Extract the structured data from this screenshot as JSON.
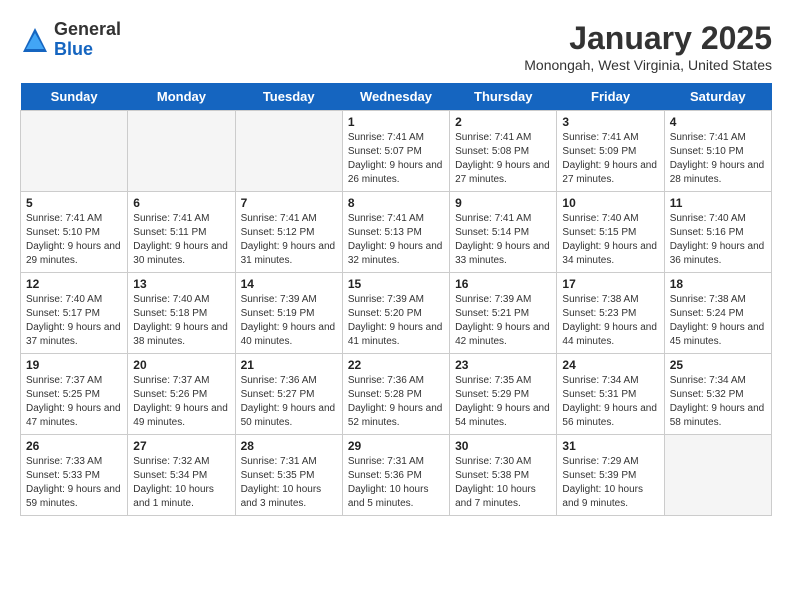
{
  "logo": {
    "general": "General",
    "blue": "Blue"
  },
  "title": "January 2025",
  "subtitle": "Monongah, West Virginia, United States",
  "days_of_week": [
    "Sunday",
    "Monday",
    "Tuesday",
    "Wednesday",
    "Thursday",
    "Friday",
    "Saturday"
  ],
  "weeks": [
    [
      {
        "day": "",
        "info": "",
        "empty": true
      },
      {
        "day": "",
        "info": "",
        "empty": true
      },
      {
        "day": "",
        "info": "",
        "empty": true
      },
      {
        "day": "1",
        "info": "Sunrise: 7:41 AM\nSunset: 5:07 PM\nDaylight: 9 hours and 26 minutes.",
        "empty": false
      },
      {
        "day": "2",
        "info": "Sunrise: 7:41 AM\nSunset: 5:08 PM\nDaylight: 9 hours and 27 minutes.",
        "empty": false
      },
      {
        "day": "3",
        "info": "Sunrise: 7:41 AM\nSunset: 5:09 PM\nDaylight: 9 hours and 27 minutes.",
        "empty": false
      },
      {
        "day": "4",
        "info": "Sunrise: 7:41 AM\nSunset: 5:10 PM\nDaylight: 9 hours and 28 minutes.",
        "empty": false
      }
    ],
    [
      {
        "day": "5",
        "info": "Sunrise: 7:41 AM\nSunset: 5:10 PM\nDaylight: 9 hours and 29 minutes.",
        "empty": false
      },
      {
        "day": "6",
        "info": "Sunrise: 7:41 AM\nSunset: 5:11 PM\nDaylight: 9 hours and 30 minutes.",
        "empty": false
      },
      {
        "day": "7",
        "info": "Sunrise: 7:41 AM\nSunset: 5:12 PM\nDaylight: 9 hours and 31 minutes.",
        "empty": false
      },
      {
        "day": "8",
        "info": "Sunrise: 7:41 AM\nSunset: 5:13 PM\nDaylight: 9 hours and 32 minutes.",
        "empty": false
      },
      {
        "day": "9",
        "info": "Sunrise: 7:41 AM\nSunset: 5:14 PM\nDaylight: 9 hours and 33 minutes.",
        "empty": false
      },
      {
        "day": "10",
        "info": "Sunrise: 7:40 AM\nSunset: 5:15 PM\nDaylight: 9 hours and 34 minutes.",
        "empty": false
      },
      {
        "day": "11",
        "info": "Sunrise: 7:40 AM\nSunset: 5:16 PM\nDaylight: 9 hours and 36 minutes.",
        "empty": false
      }
    ],
    [
      {
        "day": "12",
        "info": "Sunrise: 7:40 AM\nSunset: 5:17 PM\nDaylight: 9 hours and 37 minutes.",
        "empty": false
      },
      {
        "day": "13",
        "info": "Sunrise: 7:40 AM\nSunset: 5:18 PM\nDaylight: 9 hours and 38 minutes.",
        "empty": false
      },
      {
        "day": "14",
        "info": "Sunrise: 7:39 AM\nSunset: 5:19 PM\nDaylight: 9 hours and 40 minutes.",
        "empty": false
      },
      {
        "day": "15",
        "info": "Sunrise: 7:39 AM\nSunset: 5:20 PM\nDaylight: 9 hours and 41 minutes.",
        "empty": false
      },
      {
        "day": "16",
        "info": "Sunrise: 7:39 AM\nSunset: 5:21 PM\nDaylight: 9 hours and 42 minutes.",
        "empty": false
      },
      {
        "day": "17",
        "info": "Sunrise: 7:38 AM\nSunset: 5:23 PM\nDaylight: 9 hours and 44 minutes.",
        "empty": false
      },
      {
        "day": "18",
        "info": "Sunrise: 7:38 AM\nSunset: 5:24 PM\nDaylight: 9 hours and 45 minutes.",
        "empty": false
      }
    ],
    [
      {
        "day": "19",
        "info": "Sunrise: 7:37 AM\nSunset: 5:25 PM\nDaylight: 9 hours and 47 minutes.",
        "empty": false
      },
      {
        "day": "20",
        "info": "Sunrise: 7:37 AM\nSunset: 5:26 PM\nDaylight: 9 hours and 49 minutes.",
        "empty": false
      },
      {
        "day": "21",
        "info": "Sunrise: 7:36 AM\nSunset: 5:27 PM\nDaylight: 9 hours and 50 minutes.",
        "empty": false
      },
      {
        "day": "22",
        "info": "Sunrise: 7:36 AM\nSunset: 5:28 PM\nDaylight: 9 hours and 52 minutes.",
        "empty": false
      },
      {
        "day": "23",
        "info": "Sunrise: 7:35 AM\nSunset: 5:29 PM\nDaylight: 9 hours and 54 minutes.",
        "empty": false
      },
      {
        "day": "24",
        "info": "Sunrise: 7:34 AM\nSunset: 5:31 PM\nDaylight: 9 hours and 56 minutes.",
        "empty": false
      },
      {
        "day": "25",
        "info": "Sunrise: 7:34 AM\nSunset: 5:32 PM\nDaylight: 9 hours and 58 minutes.",
        "empty": false
      }
    ],
    [
      {
        "day": "26",
        "info": "Sunrise: 7:33 AM\nSunset: 5:33 PM\nDaylight: 9 hours and 59 minutes.",
        "empty": false
      },
      {
        "day": "27",
        "info": "Sunrise: 7:32 AM\nSunset: 5:34 PM\nDaylight: 10 hours and 1 minute.",
        "empty": false
      },
      {
        "day": "28",
        "info": "Sunrise: 7:31 AM\nSunset: 5:35 PM\nDaylight: 10 hours and 3 minutes.",
        "empty": false
      },
      {
        "day": "29",
        "info": "Sunrise: 7:31 AM\nSunset: 5:36 PM\nDaylight: 10 hours and 5 minutes.",
        "empty": false
      },
      {
        "day": "30",
        "info": "Sunrise: 7:30 AM\nSunset: 5:38 PM\nDaylight: 10 hours and 7 minutes.",
        "empty": false
      },
      {
        "day": "31",
        "info": "Sunrise: 7:29 AM\nSunset: 5:39 PM\nDaylight: 10 hours and 9 minutes.",
        "empty": false
      },
      {
        "day": "",
        "info": "",
        "empty": true
      }
    ]
  ]
}
